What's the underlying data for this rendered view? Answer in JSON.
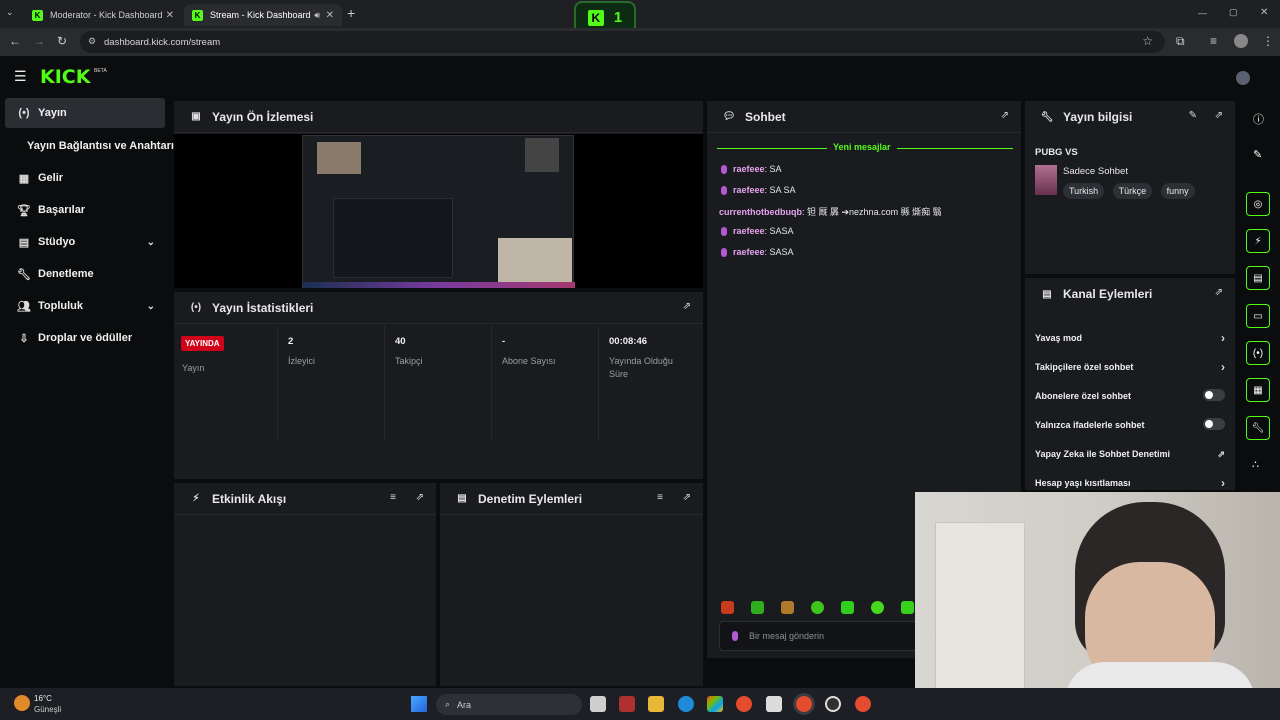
{
  "browser": {
    "tabs": [
      {
        "title": "Moderator - Kick Dashboard",
        "favicon": "kick-icon"
      },
      {
        "title": "Stream - Kick Dashboard",
        "favicon": "kick-icon"
      }
    ],
    "new_tab_glyph": "+",
    "url": "dashboard.kick.com/stream",
    "overlay_logo_text": "K",
    "overlay_count": "1"
  },
  "app": {
    "logo": "KICK",
    "logo_sup": "BETA"
  },
  "sidebar": {
    "items": [
      {
        "label": "Yayın",
        "icon": "broadcast-icon",
        "active": true
      },
      {
        "label": "Yayın Bağlantısı ve Anahtarı",
        "icon": "",
        "active": false
      },
      {
        "label": "Gelir",
        "icon": "chart-icon",
        "active": false
      },
      {
        "label": "Başarılar",
        "icon": "trophy-icon",
        "active": false
      },
      {
        "label": "Stüdyo",
        "icon": "studio-icon",
        "active": false
      },
      {
        "label": "Denetleme",
        "icon": "wrench-icon",
        "active": false
      },
      {
        "label": "Topluluk",
        "icon": "community-icon",
        "active": false
      },
      {
        "label": "Droplar ve ödüller",
        "icon": "drops-icon",
        "active": false
      }
    ]
  },
  "preview": {
    "title": "Yayın Ön İzlemesi"
  },
  "stats": {
    "title": "Yayın İstatistikleri",
    "items": [
      {
        "value": "YAYINDA",
        "label": "Yayın"
      },
      {
        "value": "2",
        "label": "İzleyici"
      },
      {
        "value": "40",
        "label": "Takipçi"
      },
      {
        "value": "-",
        "label": "Abone Sayısı"
      },
      {
        "value": "00:08:46",
        "label": "Yayında Olduğu Süre"
      }
    ]
  },
  "activity": {
    "title": "Etkinlik Akışı"
  },
  "moderation": {
    "title": "Denetim Eylemleri"
  },
  "chat": {
    "title": "Sohbet",
    "new_messages": "Yeni mesajlar",
    "messages": [
      {
        "user": "raefeee",
        "text": ": SA"
      },
      {
        "user": "raefeee",
        "text": ": SA SA"
      },
      {
        "user": "currenthotbedbuqb",
        "text": ": 钽 厩 羼 ➔nezhna.com 縣 燍痴 翳"
      },
      {
        "user": "raefeee",
        "text": ": SASA"
      },
      {
        "user": "raefeee",
        "text": ": SASA"
      }
    ],
    "input_placeholder": "Bir mesaj gönderin"
  },
  "stream_info": {
    "title": "Yayın bilgisi",
    "stream_title": "PUBG VS",
    "category": "Sadece Sohbet",
    "tags": [
      "Turkish",
      "Türkçe",
      "funny"
    ]
  },
  "channel_actions": {
    "title": "Kanal Eylemleri",
    "rows": [
      {
        "label": "Yavaş mod",
        "control": "arrow"
      },
      {
        "label": "Takipçilere özel sohbet",
        "control": "arrow"
      },
      {
        "label": "Abonelere özel sohbet",
        "control": "toggle",
        "on": false
      },
      {
        "label": "Yalnızca ifadelerle sohbet",
        "control": "toggle",
        "on": false
      },
      {
        "label": "Yapay Zeka ile Sohbet Denetimi",
        "control": "external"
      },
      {
        "label": "Hesap yaşı kısıtlaması",
        "control": "arrow"
      }
    ]
  },
  "taskbar": {
    "weather_temp": "16°C",
    "weather_desc": "Güneşli",
    "search_placeholder": "Ara"
  },
  "colors": {
    "accent": "#53fc18",
    "live_red": "#d0021b",
    "panel": "#191b1f",
    "background": "#0b0c0d"
  }
}
